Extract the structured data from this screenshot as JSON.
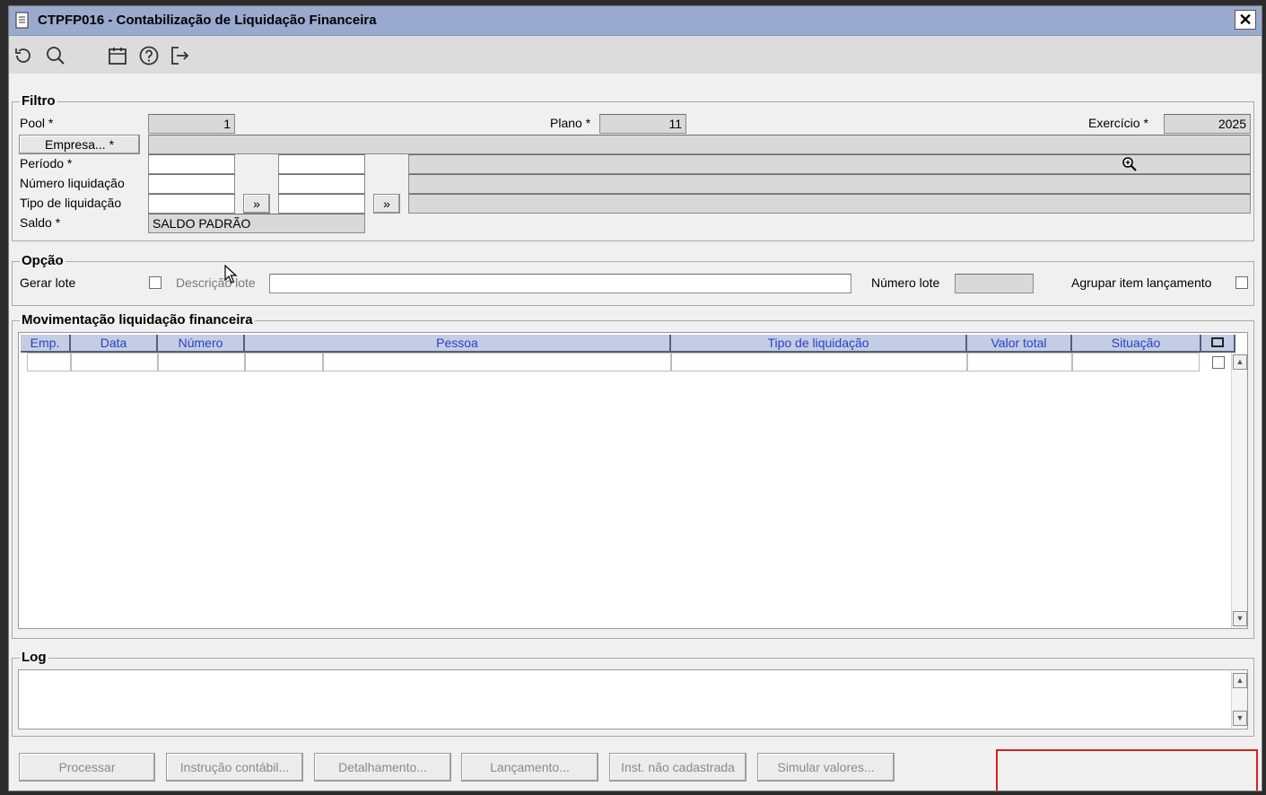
{
  "window": {
    "title": "CTPFP016 - Contabilização de Liquidação Financeira",
    "close_label": "✕"
  },
  "toolbar": {
    "icons": [
      "refresh-icon",
      "search-icon",
      "calendar-icon",
      "help-icon",
      "exit-icon"
    ]
  },
  "filtro": {
    "legend": "Filtro",
    "pool_label": "Pool *",
    "pool_value": "1",
    "plano_label": "Plano *",
    "plano_value": "11",
    "exercicio_label": "Exercício *",
    "exercicio_value": "2025",
    "empresa_button": "Empresa... *",
    "periodo_label": "Período *",
    "numero_liquidacao_label": "Número liquidação",
    "tipo_liquidacao_label": "Tipo de liquidação",
    "lookup_button": "»",
    "saldo_label": "Saldo *",
    "saldo_value": "SALDO PADRÃO"
  },
  "opcao": {
    "legend": "Opção",
    "gerar_lote_label": "Gerar lote",
    "descricao_lote_label": "Descrição lote",
    "numero_lote_label": "Número lote",
    "agrupar_label": "Agrupar item lançamento"
  },
  "movimentacao": {
    "legend": "Movimentação liquidação financeira",
    "columns": [
      "Emp.",
      "Data",
      "Número",
      "Pessoa",
      "Tipo de liquidação",
      "Valor total",
      "Situação"
    ]
  },
  "log": {
    "legend": "Log"
  },
  "buttons": {
    "processar": "Processar",
    "instrucao": "Instrução contábil...",
    "detalhamento": "Detalhamento...",
    "lancamento": "Lançamento...",
    "inst_nao_cadastrada": "Inst. não cadastrada",
    "simular": "Simular valores..."
  },
  "colors": {
    "titlebar": "#99aace",
    "grid_header": "#c3cde3",
    "grid_header_text": "#2b3fc8",
    "highlight": "#d92020"
  }
}
